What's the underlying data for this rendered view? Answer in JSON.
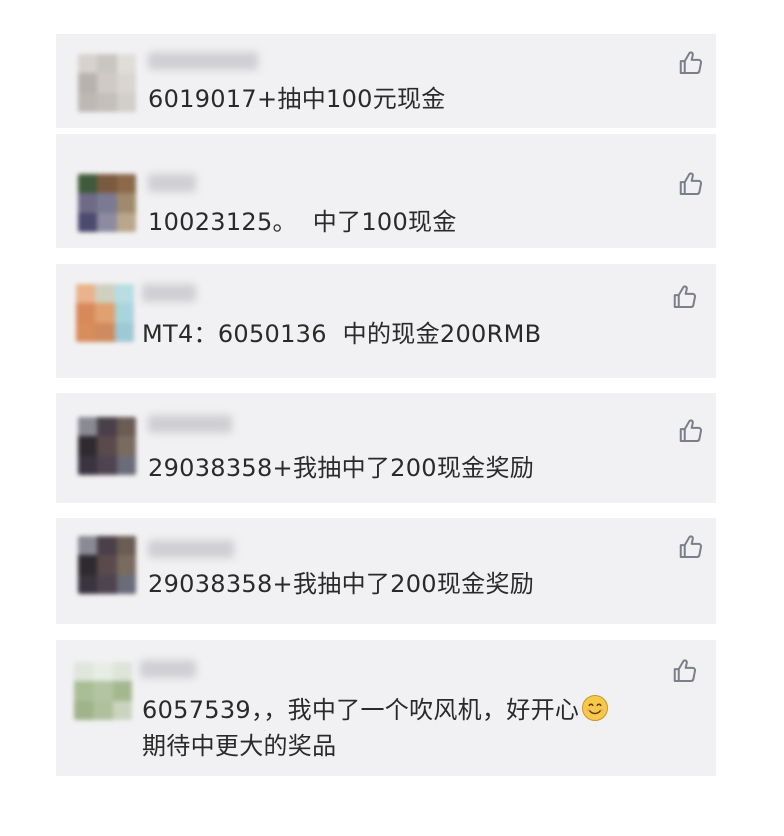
{
  "comments": [
    {
      "text": "6019017+抽中100元现金",
      "avatar_colors": [
        "#d7d2cc",
        "#c9c5c2",
        "#e0ddd9",
        "#b8b2ad",
        "#cfcac6",
        "#d9d5d1",
        "#bdb8b4",
        "#c4bfbb",
        "#d2cec9"
      ]
    },
    {
      "text": "10023125。  中了100现金",
      "avatar_colors": [
        "#3f5a3a",
        "#7a5a40",
        "#8a6a4a",
        "#6f6a86",
        "#7c7a93",
        "#a08a6c",
        "#4c4a6e",
        "#8d8aa2",
        "#b9a78a"
      ]
    },
    {
      "text": "MT4：6050136  中的现金200RMB",
      "avatar_colors": [
        "#e9b38c",
        "#cfd0c0",
        "#b7dde2",
        "#d8895a",
        "#e0a070",
        "#a9d4dc",
        "#d98c5c",
        "#cf8a5e",
        "#9ec8d4"
      ]
    },
    {
      "text": "29038358+我抽中了200现金奖励",
      "avatar_colors": [
        "#8a8a94",
        "#4a4048",
        "#6b5c54",
        "#2e2a30",
        "#5b4a4c",
        "#7a6b60",
        "#3a3440",
        "#4e4450",
        "#6a6c7a"
      ]
    },
    {
      "text": "29038358+我抽中了200现金奖励",
      "avatar_colors": [
        "#8a8a94",
        "#4a4048",
        "#6b5c54",
        "#2e2a30",
        "#5b4a4c",
        "#7a6b60",
        "#3a3440",
        "#4e4450",
        "#6a6c7a"
      ]
    },
    {
      "text_line1": "6057539，，我中了一个吹风机，好开心",
      "text_line2": "期待中更大的奖品",
      "avatar_colors": [
        "#dfe6dc",
        "#e7ece4",
        "#dde4d8",
        "#a9bd96",
        "#b3c4a2",
        "#a4b890",
        "#9fb48a",
        "#aec09c",
        "#c9d4bf"
      ]
    }
  ],
  "icons": {
    "like": "thumbs-up-icon",
    "emoji": "smiling-face-icon"
  },
  "colors": {
    "card_background": "#f1f1f3",
    "text": "#2a2a2a",
    "icon_stroke": "#7b7f8a",
    "emoji_face": "#f6c94a"
  }
}
